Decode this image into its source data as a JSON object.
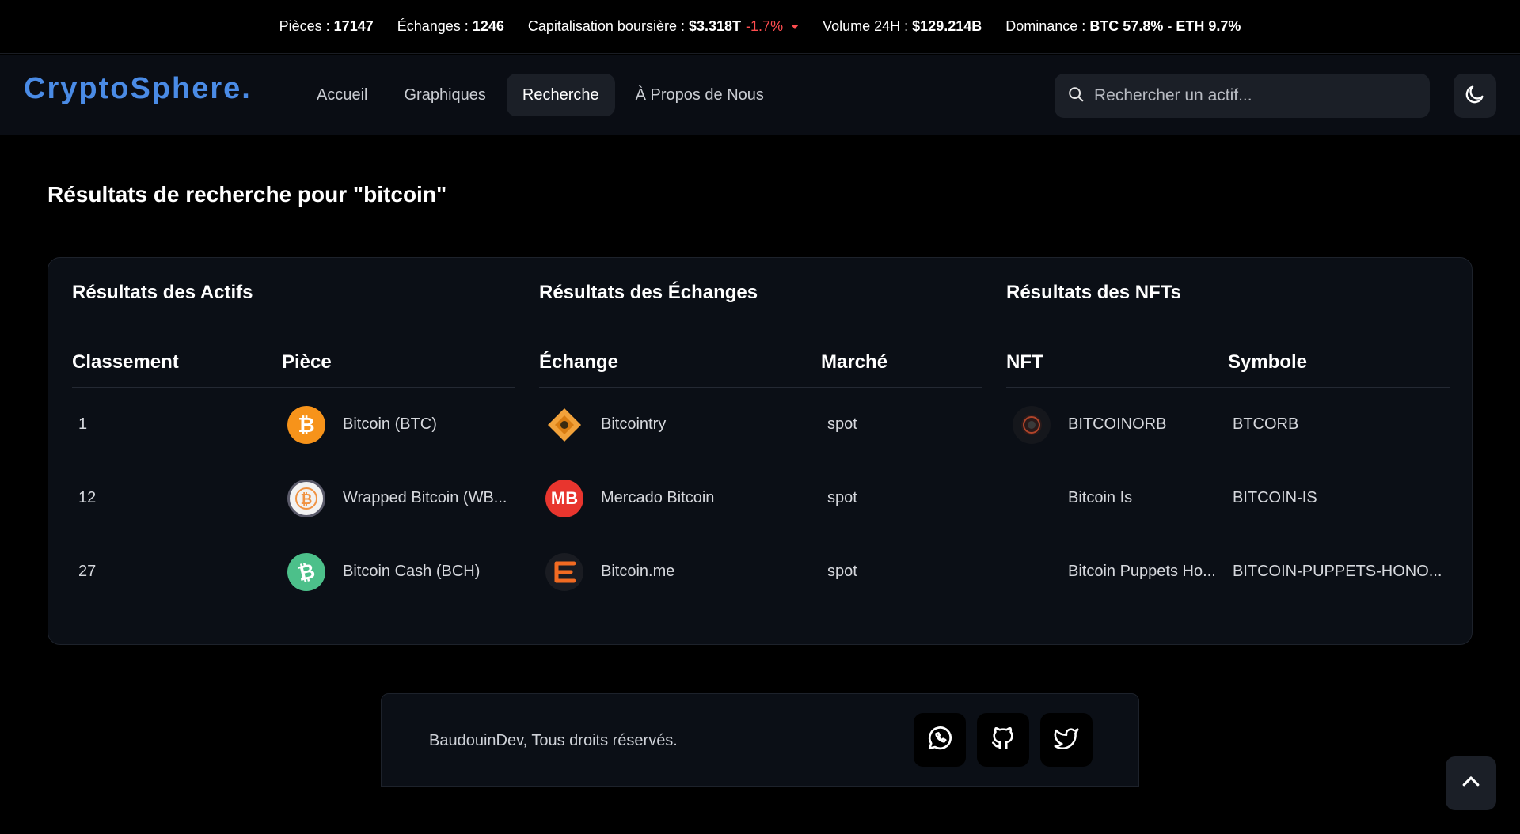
{
  "ticker": {
    "coins_label": "Pièces :",
    "coins_value": "17147",
    "exchanges_label": "Échanges :",
    "exchanges_value": "1246",
    "marketcap_label": "Capitalisation boursière :",
    "marketcap_value": "$3.318T",
    "marketcap_change": "-1.7%",
    "volume_label": "Volume 24H :",
    "volume_value": "$129.214B",
    "dominance_label": "Dominance :",
    "dominance_value": "BTC 57.8% - ETH 9.7%"
  },
  "navbar": {
    "brand": "CryptoSphere.",
    "links": [
      {
        "label": "Accueil",
        "active": false
      },
      {
        "label": "Graphiques",
        "active": false
      },
      {
        "label": "Recherche",
        "active": true
      },
      {
        "label": "À Propos de Nous",
        "active": false
      }
    ],
    "search_placeholder": "Rechercher un actif...",
    "icons": {
      "search": "search-icon",
      "theme": "moon-icon"
    }
  },
  "page": {
    "title": "Résultats de recherche pour \"bitcoin\""
  },
  "assets": {
    "title": "Résultats des Actifs",
    "headers": [
      "Classement",
      "Pièce"
    ],
    "rows": [
      {
        "rank": "1",
        "name": "Bitcoin (BTC)",
        "icon": "bitcoin-logo"
      },
      {
        "rank": "12",
        "name": "Wrapped Bitcoin (WB...",
        "icon": "wrapped-bitcoin-logo"
      },
      {
        "rank": "27",
        "name": "Bitcoin Cash (BCH)",
        "icon": "bitcoin-cash-logo"
      }
    ]
  },
  "exchanges": {
    "title": "Résultats des Échanges",
    "headers": [
      "Échange",
      "Marché"
    ],
    "rows": [
      {
        "name": "Bitcointry",
        "market": "spot",
        "icon": "bitcointry-logo"
      },
      {
        "name": "Mercado Bitcoin",
        "market": "spot",
        "icon": "mercado-bitcoin-logo",
        "icon_text": "MB"
      },
      {
        "name": "Bitcoin.me",
        "market": "spot",
        "icon": "bitcoin-me-logo"
      }
    ]
  },
  "nfts": {
    "title": "Résultats des NFTs",
    "headers": [
      "NFT",
      "Symbole"
    ],
    "rows": [
      {
        "name": "BITCOINORB",
        "symbol": "BTCORB",
        "icon": "bitcoinorb-logo"
      },
      {
        "name": "Bitcoin Is",
        "symbol": "BITCOIN-IS",
        "icon": ""
      },
      {
        "name": "Bitcoin Puppets Ho...",
        "symbol": "BITCOIN-PUPPETS-HONO...",
        "icon": ""
      }
    ]
  },
  "footer": {
    "copyright": "BaudouinDev, Tous droits réservés.",
    "social": [
      "whatsapp-icon",
      "github-icon",
      "twitter-icon"
    ]
  },
  "colors": {
    "accent": "#4a8be6",
    "negative": "#ff4d4f",
    "bitcoin": "#f7931a",
    "bitcoin_cash": "#4cc08a",
    "mercado": "#e8352e",
    "bitcoin_me": "#f26b22"
  }
}
